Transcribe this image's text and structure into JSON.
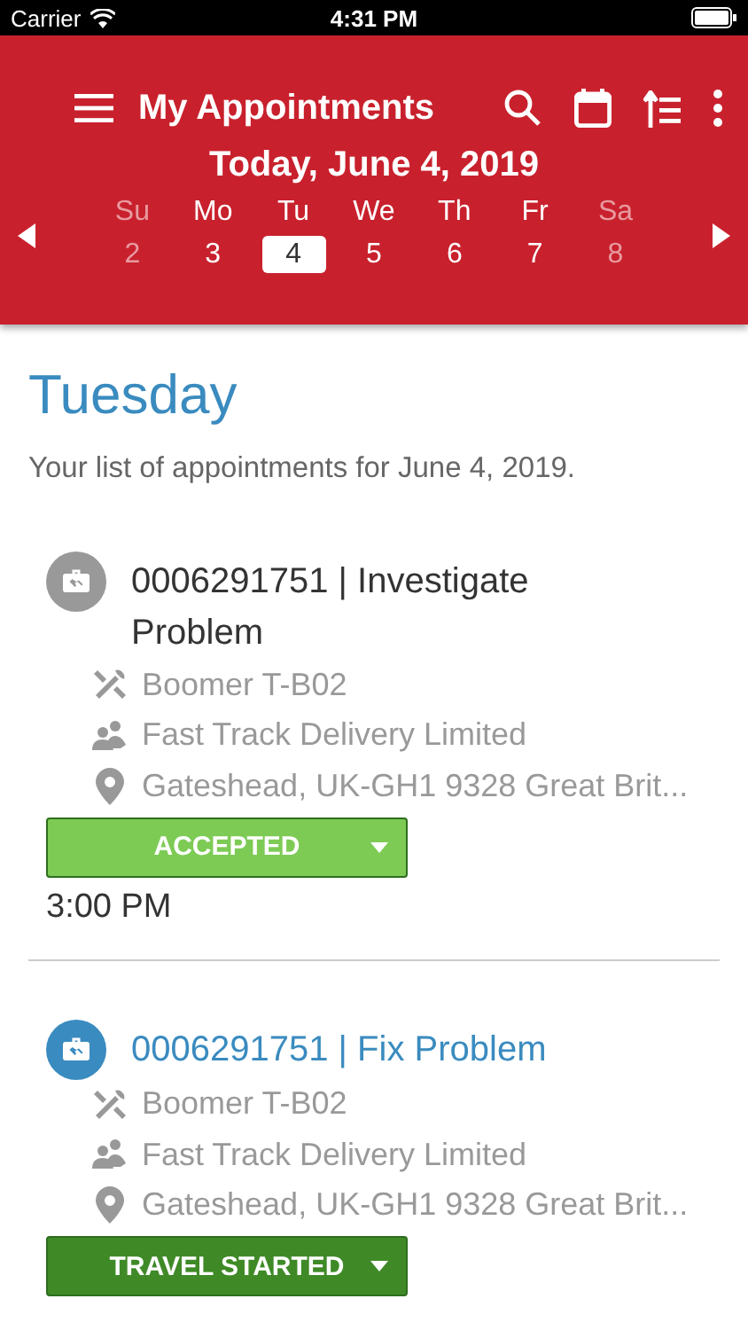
{
  "status_bar": {
    "carrier": "Carrier",
    "time": "4:31 PM"
  },
  "header": {
    "title": "My Appointments",
    "date": "Today, June 4, 2019"
  },
  "days": [
    {
      "name": "Su",
      "number": "2",
      "disabled": true,
      "selected": false
    },
    {
      "name": "Mo",
      "number": "3",
      "disabled": false,
      "selected": false
    },
    {
      "name": "Tu",
      "number": "4",
      "disabled": false,
      "selected": true
    },
    {
      "name": "We",
      "number": "5",
      "disabled": false,
      "selected": false
    },
    {
      "name": "Th",
      "number": "6",
      "disabled": false,
      "selected": false
    },
    {
      "name": "Fr",
      "number": "7",
      "disabled": false,
      "selected": false
    },
    {
      "name": "Sa",
      "number": "8",
      "disabled": true,
      "selected": false
    }
  ],
  "heading": "Tuesday",
  "subtitle": "Your list of appointments for June 4, 2019.",
  "appointments": [
    {
      "title": "0006291751 | Investigate Problem",
      "active": false,
      "equipment": "Boomer T-B02",
      "customer": "Fast Track Delivery Limited",
      "address": "Gateshead, UK-GH1 9328 Great Brit...",
      "status": "ACCEPTED",
      "color": "#7dcb55",
      "time": "3:00 PM"
    },
    {
      "title": "0006291751 | Fix Problem",
      "active": true,
      "equipment": "Boomer T-B02",
      "customer": "Fast Track Delivery Limited",
      "address": "Gateshead, UK-GH1 9328 Great Brit...",
      "status": "TRAVEL STARTED",
      "color": "#3f8a27"
    }
  ]
}
